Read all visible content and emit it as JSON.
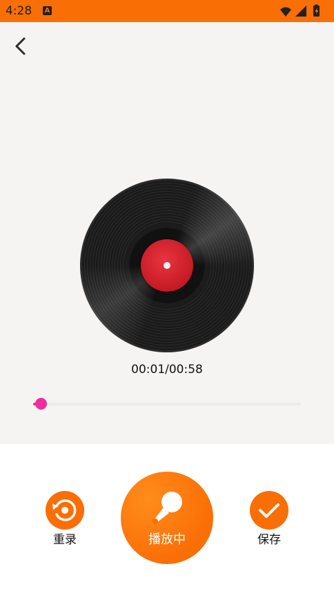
{
  "status_bar": {
    "time": "4:28",
    "app_icon": "A",
    "bg_color": "#fa6e06"
  },
  "player": {
    "time_display": "00:01/00:58",
    "progress": 0.03,
    "accent_color": "#f12c9b",
    "disc_icon": "vinyl-record"
  },
  "actions": {
    "rerecord_label": "重录",
    "play_label": "播放中",
    "save_label": "保存",
    "button_color": "#fa6e06"
  },
  "icons": {
    "back": "chevron-left-icon",
    "rerecord": "replay-icon",
    "play": "microphone-icon",
    "save": "check-icon"
  }
}
